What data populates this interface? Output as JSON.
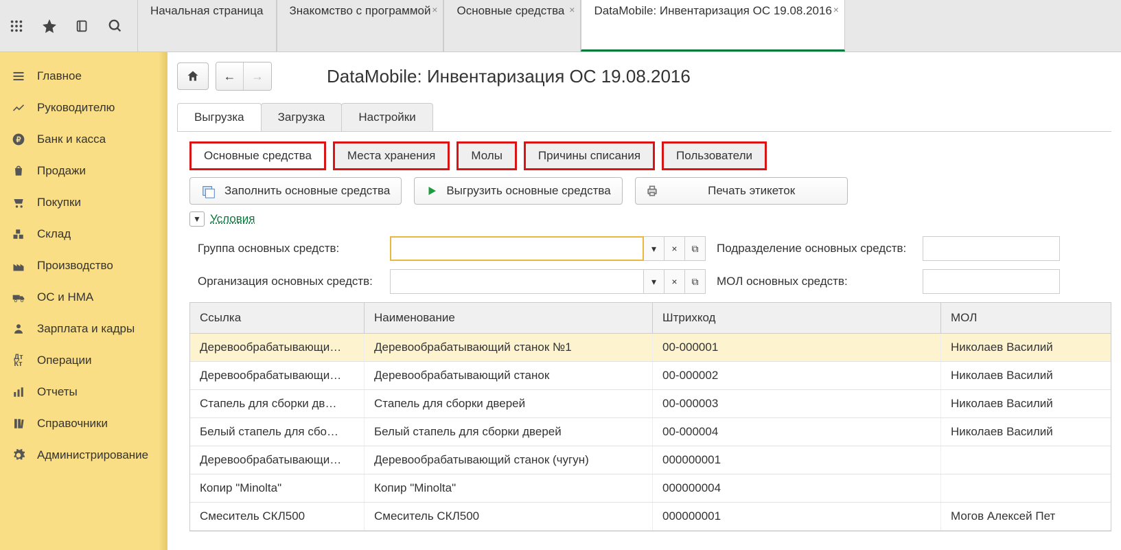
{
  "app_tabs": [
    {
      "label": "Начальная страница",
      "closable": false
    },
    {
      "label": "Знакомство с программой",
      "closable": true
    },
    {
      "label": "Основные средства",
      "closable": true
    },
    {
      "label": "DataMobile: Инвентаризация ОС 19.08.2016",
      "closable": true,
      "active": true
    }
  ],
  "sidebar": [
    {
      "label": "Главное",
      "icon": "menu"
    },
    {
      "label": "Руководителю",
      "icon": "chart"
    },
    {
      "label": "Банк и касса",
      "icon": "ruble"
    },
    {
      "label": "Продажи",
      "icon": "bag"
    },
    {
      "label": "Покупки",
      "icon": "cart"
    },
    {
      "label": "Склад",
      "icon": "boxes"
    },
    {
      "label": "Производство",
      "icon": "factory"
    },
    {
      "label": "ОС и НМА",
      "icon": "truck"
    },
    {
      "label": "Зарплата и кадры",
      "icon": "person"
    },
    {
      "label": "Операции",
      "icon": "debit"
    },
    {
      "label": "Отчеты",
      "icon": "bars"
    },
    {
      "label": "Справочники",
      "icon": "books"
    },
    {
      "label": "Администрирование",
      "icon": "gear"
    }
  ],
  "page_title": "DataMobile: Инвентаризация ОС 19.08.2016",
  "upper_tabs": [
    {
      "label": "Выгрузка",
      "active": true
    },
    {
      "label": "Загрузка"
    },
    {
      "label": "Настройки"
    }
  ],
  "sub_tabs": [
    {
      "label": "Основные средства",
      "active": true
    },
    {
      "label": "Места хранения"
    },
    {
      "label": "Молы"
    },
    {
      "label": "Причины списания"
    },
    {
      "label": "Пользователи"
    }
  ],
  "actions": {
    "fill": "Заполнить основные средства",
    "export": "Выгрузить основные средства",
    "print": "Печать этикеток"
  },
  "conditions_label": "Условия",
  "form": {
    "group_label": "Группа основных средств:",
    "dept_label": "Подразделение основных средств:",
    "org_label": "Организация основных средств:",
    "mol_label": "МОЛ основных средств:"
  },
  "table": {
    "headers": [
      "Ссылка",
      "Наименование",
      "Штрихкод",
      "МОЛ"
    ],
    "rows": [
      {
        "ref": "Деревообрабатывающи…",
        "name": "Деревообрабатывающий станок №1",
        "barcode": "00-000001",
        "mol": "Николаев Василий",
        "selected": true
      },
      {
        "ref": "Деревообрабатывающи…",
        "name": "Деревообрабатывающий станок",
        "barcode": "00-000002",
        "mol": "Николаев Василий"
      },
      {
        "ref": "Стапель для сборки дв…",
        "name": "Стапель для сборки дверей",
        "barcode": "00-000003",
        "mol": "Николаев Василий"
      },
      {
        "ref": "Белый стапель для сбо…",
        "name": "Белый стапель для сборки дверей",
        "barcode": "00-000004",
        "mol": "Николаев Василий"
      },
      {
        "ref": "Деревообрабатывающи…",
        "name": "Деревообрабатывающий станок (чугун)",
        "barcode": "000000001",
        "mol": ""
      },
      {
        "ref": "Копир \"Minolta\"",
        "name": "Копир \"Minolta\"",
        "barcode": "000000004",
        "mol": ""
      },
      {
        "ref": "Смеситель СКЛ500",
        "name": "Смеситель СКЛ500",
        "barcode": "000000001",
        "mol": "Могов Алексей Пет"
      }
    ]
  }
}
